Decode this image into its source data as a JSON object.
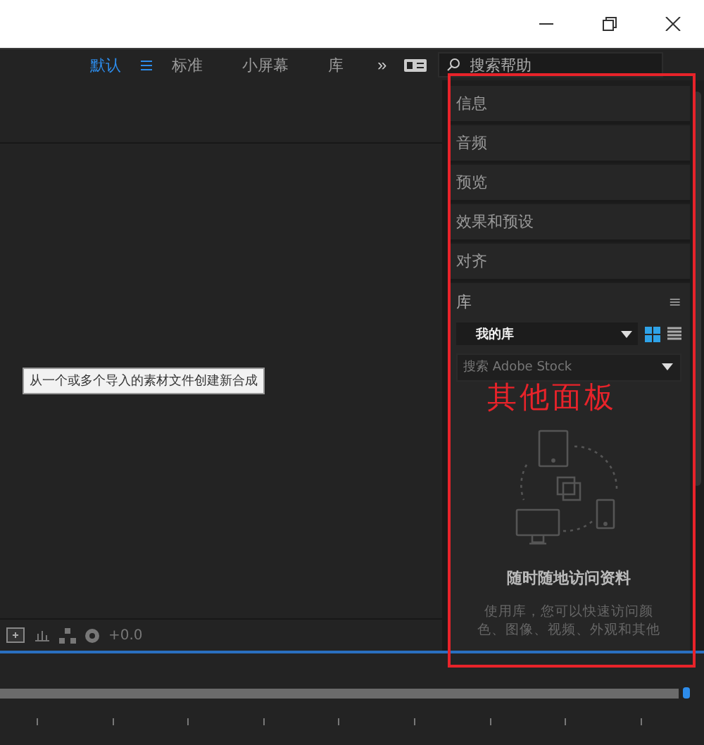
{
  "workspace_tabs": [
    {
      "label": "默认",
      "selected": true
    },
    {
      "label": "标准",
      "selected": false
    },
    {
      "label": "小屏幕",
      "selected": false
    },
    {
      "label": "库",
      "selected": false
    }
  ],
  "workspace_more": "»",
  "help_search": {
    "placeholder": "搜索帮助"
  },
  "composition": {
    "tooltip": "从一个或多个导入的素材文件创建新合成",
    "exposure": "+0.0"
  },
  "panels": [
    "信息",
    "音频",
    "预览",
    "效果和预设",
    "对齐"
  ],
  "library": {
    "title": "库",
    "menu": "≡",
    "selector": "我的库",
    "view_grid_selected": true,
    "search": {
      "placeholder": "搜索 Adobe Stock"
    },
    "heading": "随时随地访问资料",
    "description": "使用库，您可以快速访问颜色、图像、视频、外观和其他"
  },
  "annotation": {
    "label": "其他面板",
    "color": "#e8232a"
  }
}
